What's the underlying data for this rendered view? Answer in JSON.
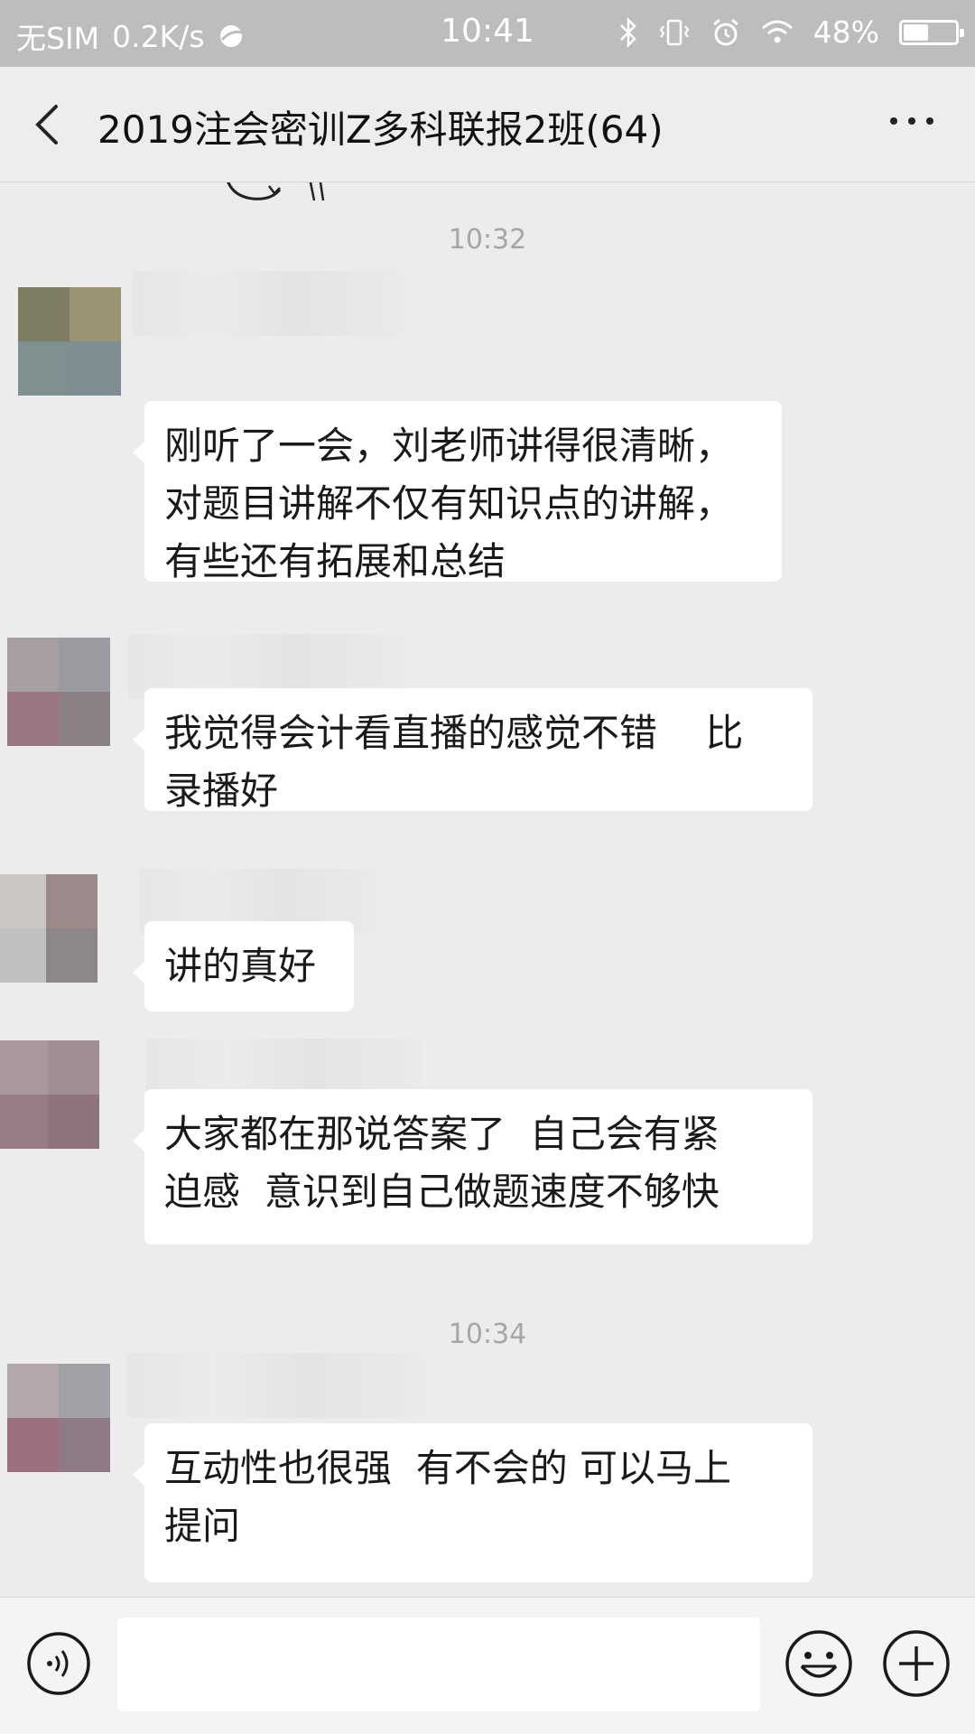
{
  "status_bar": {
    "carrier": "无SIM",
    "speed": "0.2K/s",
    "time": "10:41",
    "battery": "48%",
    "battery_level": 0.48
  },
  "header": {
    "title": "2019注会密训Z多科联报2班(64)",
    "back_icon": "chevron-left-icon",
    "more_icon": "more-dots-icon"
  },
  "chat": {
    "timestamps": [
      "10:32",
      "10:34"
    ],
    "messages": [
      {
        "text": "刚听了一会，刘老师讲得很清晰，\n对题目讲解不仅有知识点的讲解，\n有些还有拓展和总结"
      },
      {
        "text": "我觉得会计看直播的感觉不错    比\n录播好"
      },
      {
        "text": "讲的真好"
      },
      {
        "text": "大家都在那说答案了  自己会有紧\n迫感  意识到自己做题速度不够快"
      },
      {
        "text": "互动性也很强  有不会的 可以马上\n提问"
      }
    ]
  },
  "input_bar": {
    "placeholder": "",
    "icons": [
      "voice-icon",
      "emoji-icon",
      "plus-icon"
    ]
  },
  "colors": {
    "background": "#ececec",
    "status_bar": "#bdbdbd",
    "bubble": "#ffffff",
    "timestamp": "#a6a6a6"
  }
}
